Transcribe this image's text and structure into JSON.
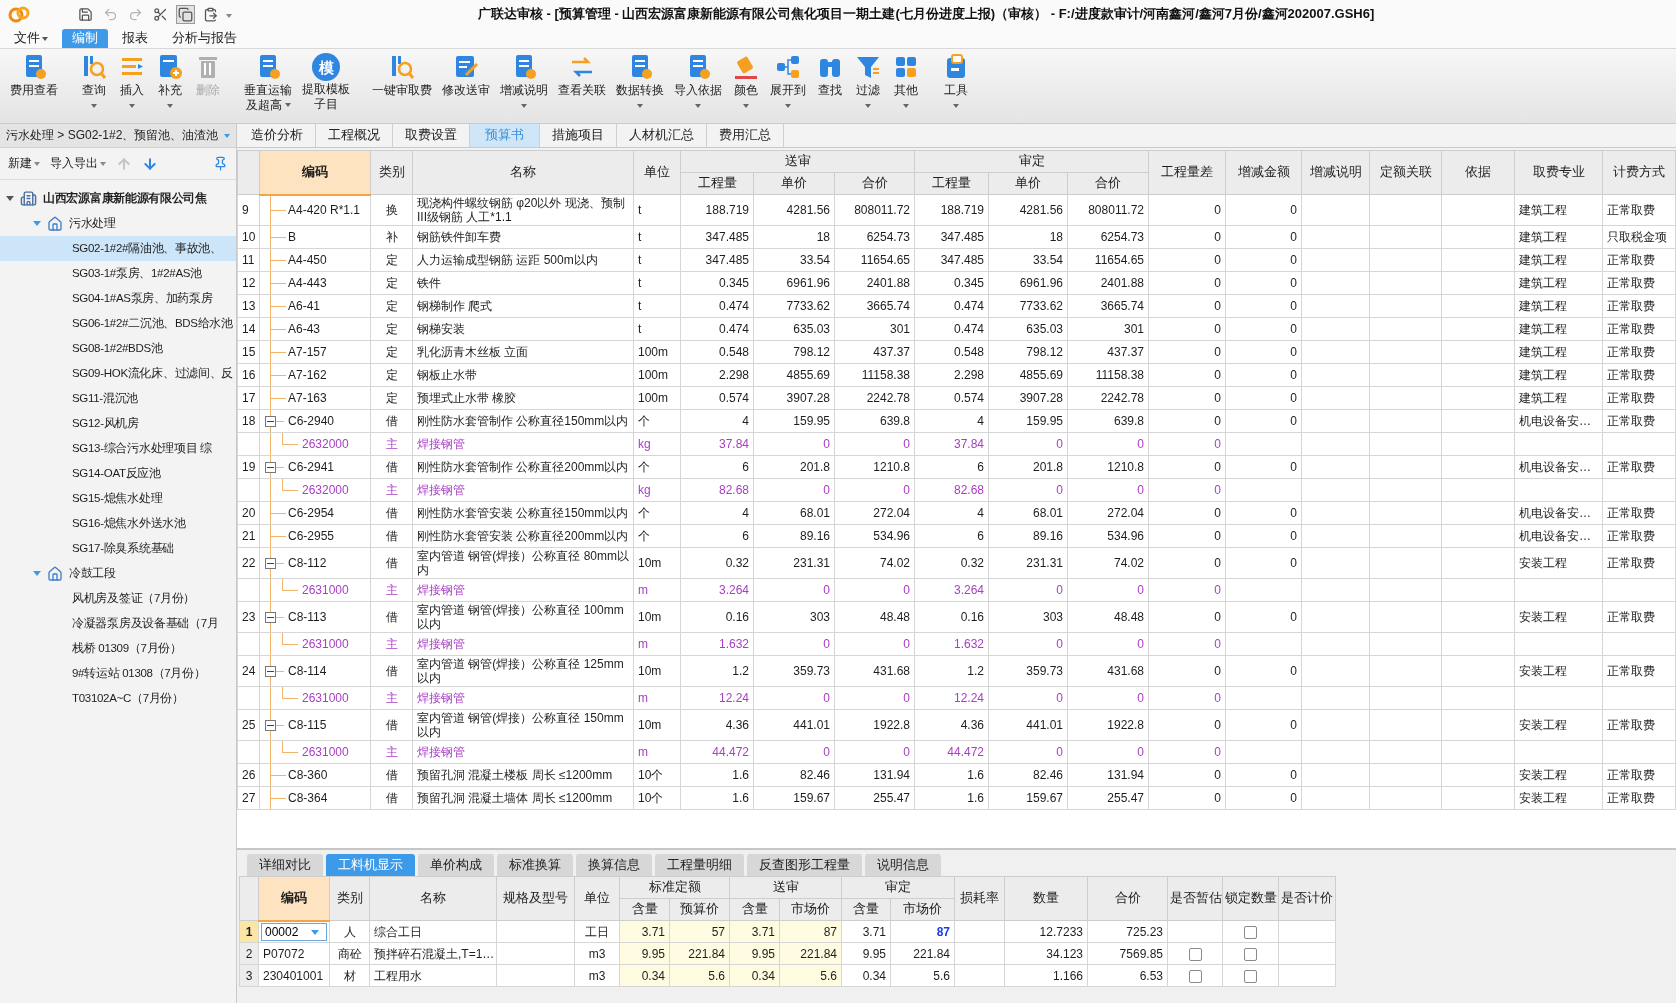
{
  "title_bar": {
    "quick_access": [
      {
        "disabled": false
      },
      {
        "disabled": true
      },
      {
        "disabled": true
      },
      {
        "disabled": false
      },
      {
        "disabled": false
      },
      {
        "disabled": false
      }
    ],
    "title": "广联达审核 - [预算管理 - 山西宏源富康新能源有限公司焦化项目一期土建(七月份进度上报)（审核） - F:/进度款审计/河南鑫河/鑫河7月份/鑫河202007.GSH6]"
  },
  "menu": [
    {
      "label": "文件",
      "dropdown": true,
      "selected": false
    },
    {
      "label": "编制",
      "dropdown": false,
      "selected": true
    },
    {
      "label": "报表",
      "dropdown": false,
      "selected": false
    },
    {
      "label": "分析与报告",
      "dropdown": false,
      "selected": false
    }
  ],
  "toolbar": [
    {
      "buttons": [
        {
          "lines": [
            "费用查看"
          ],
          "dropdown": false,
          "disabled": false
        }
      ]
    },
    {
      "buttons": [
        {
          "lines": [
            "查询"
          ],
          "dropdown": true,
          "disabled": false
        },
        {
          "lines": [
            "插入"
          ],
          "dropdown": true,
          "disabled": false
        },
        {
          "lines": [
            "补充"
          ],
          "dropdown": true,
          "disabled": false
        },
        {
          "lines": [
            "删除"
          ],
          "dropdown": false,
          "disabled": true
        }
      ]
    },
    {
      "buttons": [
        {
          "lines": [
            "垂直运输",
            "及超高"
          ],
          "dropdown": true,
          "disabled": false
        },
        {
          "lines": [
            "提取模板",
            "子目"
          ],
          "dropdown": false,
          "disabled": false,
          "glyph": "模"
        }
      ]
    },
    {
      "buttons": [
        {
          "lines": [
            "一键审取费"
          ],
          "dropdown": false,
          "disabled": false
        },
        {
          "lines": [
            "修改送审"
          ],
          "dropdown": false,
          "disabled": false
        },
        {
          "lines": [
            "增减说明"
          ],
          "dropdown": true,
          "disabled": false
        },
        {
          "lines": [
            "查看关联"
          ],
          "dropdown": false,
          "disabled": false
        },
        {
          "lines": [
            "数据转换"
          ],
          "dropdown": true,
          "disabled": false
        },
        {
          "lines": [
            "导入依据"
          ],
          "dropdown": true,
          "disabled": false
        },
        {
          "lines": [
            "颜色"
          ],
          "dropdown": true,
          "disabled": false
        },
        {
          "lines": [
            "展开到"
          ],
          "dropdown": true,
          "disabled": false
        },
        {
          "lines": [
            "查找"
          ],
          "dropdown": false,
          "disabled": false
        },
        {
          "lines": [
            "过滤"
          ],
          "dropdown": true,
          "disabled": false
        },
        {
          "lines": [
            "其他"
          ],
          "dropdown": true,
          "disabled": false
        }
      ]
    },
    {
      "buttons": [
        {
          "lines": [
            "工具"
          ],
          "dropdown": true,
          "disabled": false
        }
      ]
    }
  ],
  "sidebar": {
    "breadcrumb": "污水处理 > SG02-1#2、预留池、油渣池",
    "tools": [
      {
        "label": "新建",
        "dropdown": true
      },
      {
        "label": "导入导出",
        "dropdown": true
      }
    ],
    "arrows": [
      {
        "disabled": true
      },
      {
        "disabled": false
      }
    ],
    "tree": [
      {
        "label": "山西宏源富康新能源有限公司焦",
        "expanded": true,
        "children": [
          {
            "label": "污水处理",
            "expanded": true,
            "children": [
              {
                "label": "SG02-1#2#隔油池、事故池、",
                "selected": true
              },
              {
                "label": "SG03-1#泵房、1#2#AS池",
                "selected": false
              },
              {
                "label": "SG04-1#AS泵房、加药泵房",
                "selected": false
              },
              {
                "label": "SG06-1#2#二沉池、BDS给水池",
                "selected": false
              },
              {
                "label": "SG08-1#2#BDS池",
                "selected": false
              },
              {
                "label": "SG09-HOK流化床、过滤间、反",
                "selected": false
              },
              {
                "label": "SG11-混沉池",
                "selected": false
              },
              {
                "label": "SG12-风机房",
                "selected": false
              },
              {
                "label": "SG13-综合污水处理项目  综",
                "selected": false
              },
              {
                "label": "SG14-OAT反应池",
                "selected": false
              },
              {
                "label": "SG15-熄焦水处理",
                "selected": false
              },
              {
                "label": "SG16-熄焦水外送水池",
                "selected": false
              },
              {
                "label": "SG17-除臭系统基础",
                "selected": false
              }
            ]
          },
          {
            "label": "冷鼓工段",
            "expanded": true,
            "children": [
              {
                "label": "风机房及签证（7月份）",
                "selected": false
              },
              {
                "label": "冷凝器泵房及设备基础（7月",
                "selected": false
              },
              {
                "label": "栈桥 01309（7月份）",
                "selected": false
              },
              {
                "label": "9#转运站 01308（7月份）",
                "selected": false
              },
              {
                "label": "T03102A~C（7月份）",
                "selected": false
              }
            ]
          }
        ]
      }
    ]
  },
  "tabs": [
    {
      "label": "造价分析",
      "selected": false
    },
    {
      "label": "工程概况",
      "selected": false
    },
    {
      "label": "取费设置",
      "selected": false
    },
    {
      "label": "预算书",
      "selected": true
    },
    {
      "label": "措施项目",
      "selected": false
    },
    {
      "label": "人材机汇总",
      "selected": false
    },
    {
      "label": "费用汇总",
      "selected": false
    }
  ],
  "main_table": {
    "header": [
      {
        "label": "编码",
        "selected": true
      },
      {
        "label": "类别",
        "selected": false
      },
      {
        "label": "名称",
        "selected": false
      },
      {
        "label": "单位",
        "selected": false
      },
      {
        "group": "送审",
        "columns": [
          "工程量",
          "单价",
          "合价"
        ]
      },
      {
        "group": "审定",
        "columns": [
          "工程量",
          "单价",
          "合价"
        ]
      },
      {
        "label": "工程量差",
        "selected": false
      },
      {
        "label": "增减金额",
        "selected": false
      },
      {
        "label": "增减说明",
        "selected": false
      },
      {
        "label": "定额关联",
        "selected": false
      },
      {
        "label": "依据",
        "selected": false
      },
      {
        "label": "取费专业",
        "selected": false
      },
      {
        "label": "计费方式",
        "selected": false
      }
    ],
    "rows": [
      {
        "kind": "item",
        "n": "9",
        "code": "A4-420 R*1.1",
        "type": "换",
        "name": "现浇构件螺纹钢筋 φ20以外  现浇、预制III级钢筋 人工*1.1",
        "unit": "t",
        "sent_qty": "188.719",
        "sent_price": "4281.56",
        "sent_total": "808011.72",
        "appr_qty": "188.719",
        "appr_price": "4281.56",
        "appr_total": "808011.72",
        "qty_diff": "0",
        "change_amount": "0",
        "fee_type": "建筑工程",
        "charge_method": "正常取费"
      },
      {
        "kind": "item",
        "n": "10",
        "code": "B",
        "type": "补",
        "name": "钢筋铁件卸车费",
        "unit": "t",
        "sent_qty": "347.485",
        "sent_price": "18",
        "sent_total": "6254.73",
        "appr_qty": "347.485",
        "appr_price": "18",
        "appr_total": "6254.73",
        "qty_diff": "0",
        "change_amount": "0",
        "fee_type": "建筑工程",
        "charge_method": "只取税金项"
      },
      {
        "kind": "item",
        "n": "11",
        "code": "A4-450",
        "type": "定",
        "name": "人力运输成型钢筋 运距 500m以内",
        "unit": "t",
        "sent_qty": "347.485",
        "sent_price": "33.54",
        "sent_total": "11654.65",
        "appr_qty": "347.485",
        "appr_price": "33.54",
        "appr_total": "11654.65",
        "qty_diff": "0",
        "change_amount": "0",
        "fee_type": "建筑工程",
        "charge_method": "正常取费"
      },
      {
        "kind": "item",
        "n": "12",
        "code": "A4-443",
        "type": "定",
        "name": "铁件",
        "unit": "t",
        "sent_qty": "0.345",
        "sent_price": "6961.96",
        "sent_total": "2401.88",
        "appr_qty": "0.345",
        "appr_price": "6961.96",
        "appr_total": "2401.88",
        "qty_diff": "0",
        "change_amount": "0",
        "fee_type": "建筑工程",
        "charge_method": "正常取费"
      },
      {
        "kind": "item",
        "n": "13",
        "code": "A6-41",
        "type": "定",
        "name": "钢梯制作 爬式",
        "unit": "t",
        "sent_qty": "0.474",
        "sent_price": "7733.62",
        "sent_total": "3665.74",
        "appr_qty": "0.474",
        "appr_price": "7733.62",
        "appr_total": "3665.74",
        "qty_diff": "0",
        "change_amount": "0",
        "fee_type": "建筑工程",
        "charge_method": "正常取费"
      },
      {
        "kind": "item",
        "n": "14",
        "code": "A6-43",
        "type": "定",
        "name": "钢梯安装",
        "unit": "t",
        "sent_qty": "0.474",
        "sent_price": "635.03",
        "sent_total": "301",
        "appr_qty": "0.474",
        "appr_price": "635.03",
        "appr_total": "301",
        "qty_diff": "0",
        "change_amount": "0",
        "fee_type": "建筑工程",
        "charge_method": "正常取费"
      },
      {
        "kind": "item",
        "n": "15",
        "code": "A7-157",
        "type": "定",
        "name": "乳化沥青木丝板 立面",
        "unit": "100m",
        "sent_qty": "0.548",
        "sent_price": "798.12",
        "sent_total": "437.37",
        "appr_qty": "0.548",
        "appr_price": "798.12",
        "appr_total": "437.37",
        "qty_diff": "0",
        "change_amount": "0",
        "fee_type": "建筑工程",
        "charge_method": "正常取费"
      },
      {
        "kind": "item",
        "n": "16",
        "code": "A7-162",
        "type": "定",
        "name": "钢板止水带",
        "unit": "100m",
        "sent_qty": "2.298",
        "sent_price": "4855.69",
        "sent_total": "11158.38",
        "appr_qty": "2.298",
        "appr_price": "4855.69",
        "appr_total": "11158.38",
        "qty_diff": "0",
        "change_amount": "0",
        "fee_type": "建筑工程",
        "charge_method": "正常取费"
      },
      {
        "kind": "item",
        "n": "17",
        "code": "A7-163",
        "type": "定",
        "name": "预埋式止水带 橡胶",
        "unit": "100m",
        "sent_qty": "0.574",
        "sent_price": "3907.28",
        "sent_total": "2242.78",
        "appr_qty": "0.574",
        "appr_price": "3907.28",
        "appr_total": "2242.78",
        "qty_diff": "0",
        "change_amount": "0",
        "fee_type": "建筑工程",
        "charge_method": "正常取费"
      },
      {
        "kind": "item",
        "n": "18",
        "code": "C6-2940",
        "type": "借",
        "name": "刚性防水套管制作 公称直径150mm以内",
        "unit": "个",
        "sent_qty": "4",
        "sent_price": "159.95",
        "sent_total": "639.8",
        "appr_qty": "4",
        "appr_price": "159.95",
        "appr_total": "639.8",
        "qty_diff": "0",
        "change_amount": "0",
        "fee_type": "机电设备安…",
        "charge_method": "正常取费",
        "expanded": true,
        "children": [
          {
            "kind": "material",
            "code": "2632000",
            "type": "主",
            "name": "焊接钢管",
            "unit": "kg",
            "sent_qty": "37.84",
            "sent_price": "0",
            "sent_total": "0",
            "appr_qty": "37.84",
            "appr_price": "0",
            "appr_total": "0",
            "qty_diff": "0"
          }
        ]
      },
      {
        "kind": "item",
        "n": "19",
        "code": "C6-2941",
        "type": "借",
        "name": "刚性防水套管制作 公称直径200mm以内",
        "unit": "个",
        "sent_qty": "6",
        "sent_price": "201.8",
        "sent_total": "1210.8",
        "appr_qty": "6",
        "appr_price": "201.8",
        "appr_total": "1210.8",
        "qty_diff": "0",
        "change_amount": "0",
        "fee_type": "机电设备安…",
        "charge_method": "正常取费",
        "expanded": true,
        "children": [
          {
            "kind": "material",
            "code": "2632000",
            "type": "主",
            "name": "焊接钢管",
            "unit": "kg",
            "sent_qty": "82.68",
            "sent_price": "0",
            "sent_total": "0",
            "appr_qty": "82.68",
            "appr_price": "0",
            "appr_total": "0",
            "qty_diff": "0"
          }
        ]
      },
      {
        "kind": "item",
        "n": "20",
        "code": "C6-2954",
        "type": "借",
        "name": "刚性防水套管安装 公称直径150mm以内",
        "unit": "个",
        "sent_qty": "4",
        "sent_price": "68.01",
        "sent_total": "272.04",
        "appr_qty": "4",
        "appr_price": "68.01",
        "appr_total": "272.04",
        "qty_diff": "0",
        "change_amount": "0",
        "fee_type": "机电设备安…",
        "charge_method": "正常取费"
      },
      {
        "kind": "item",
        "n": "21",
        "code": "C6-2955",
        "type": "借",
        "name": "刚性防水套管安装 公称直径200mm以内",
        "unit": "个",
        "sent_qty": "6",
        "sent_price": "89.16",
        "sent_total": "534.96",
        "appr_qty": "6",
        "appr_price": "89.16",
        "appr_total": "534.96",
        "qty_diff": "0",
        "change_amount": "0",
        "fee_type": "机电设备安…",
        "charge_method": "正常取费"
      },
      {
        "kind": "item",
        "n": "22",
        "code": "C8-112",
        "type": "借",
        "name": "室内管道 钢管(焊接）公称直径 80mm以内",
        "unit": "10m",
        "sent_qty": "0.32",
        "sent_price": "231.31",
        "sent_total": "74.02",
        "appr_qty": "0.32",
        "appr_price": "231.31",
        "appr_total": "74.02",
        "qty_diff": "0",
        "change_amount": "0",
        "fee_type": "安装工程",
        "charge_method": "正常取费",
        "expanded": true,
        "children": [
          {
            "kind": "material",
            "code": "2631000",
            "type": "主",
            "name": "焊接钢管",
            "unit": "m",
            "sent_qty": "3.264",
            "sent_price": "0",
            "sent_total": "0",
            "appr_qty": "3.264",
            "appr_price": "0",
            "appr_total": "0",
            "qty_diff": "0"
          }
        ]
      },
      {
        "kind": "item",
        "n": "23",
        "code": "C8-113",
        "type": "借",
        "name": "室内管道 钢管(焊接）公称直径 100mm以内",
        "unit": "10m",
        "sent_qty": "0.16",
        "sent_price": "303",
        "sent_total": "48.48",
        "appr_qty": "0.16",
        "appr_price": "303",
        "appr_total": "48.48",
        "qty_diff": "0",
        "change_amount": "0",
        "fee_type": "安装工程",
        "charge_method": "正常取费",
        "expanded": true,
        "children": [
          {
            "kind": "material",
            "code": "2631000",
            "type": "主",
            "name": "焊接钢管",
            "unit": "m",
            "sent_qty": "1.632",
            "sent_price": "0",
            "sent_total": "0",
            "appr_qty": "1.632",
            "appr_price": "0",
            "appr_total": "0",
            "qty_diff": "0"
          }
        ]
      },
      {
        "kind": "item",
        "n": "24",
        "code": "C8-114",
        "type": "借",
        "name": "室内管道 钢管(焊接）公称直径 125mm以内",
        "unit": "10m",
        "sent_qty": "1.2",
        "sent_price": "359.73",
        "sent_total": "431.68",
        "appr_qty": "1.2",
        "appr_price": "359.73",
        "appr_total": "431.68",
        "qty_diff": "0",
        "change_amount": "0",
        "fee_type": "安装工程",
        "charge_method": "正常取费",
        "expanded": true,
        "children": [
          {
            "kind": "material",
            "code": "2631000",
            "type": "主",
            "name": "焊接钢管",
            "unit": "m",
            "sent_qty": "12.24",
            "sent_price": "0",
            "sent_total": "0",
            "appr_qty": "12.24",
            "appr_price": "0",
            "appr_total": "0",
            "qty_diff": "0"
          }
        ]
      },
      {
        "kind": "item",
        "n": "25",
        "code": "C8-115",
        "type": "借",
        "name": "室内管道 钢管(焊接）公称直径 150mm以内",
        "unit": "10m",
        "sent_qty": "4.36",
        "sent_price": "441.01",
        "sent_total": "1922.8",
        "appr_qty": "4.36",
        "appr_price": "441.01",
        "appr_total": "1922.8",
        "qty_diff": "0",
        "change_amount": "0",
        "fee_type": "安装工程",
        "charge_method": "正常取费",
        "expanded": true,
        "children": [
          {
            "kind": "material",
            "code": "2631000",
            "type": "主",
            "name": "焊接钢管",
            "unit": "m",
            "sent_qty": "44.472",
            "sent_price": "0",
            "sent_total": "0",
            "appr_qty": "44.472",
            "appr_price": "0",
            "appr_total": "0",
            "qty_diff": "0"
          }
        ]
      },
      {
        "kind": "item",
        "n": "26",
        "code": "C8-360",
        "type": "借",
        "name": "预留孔洞 混凝土楼板 周长 ≤1200mm",
        "unit": "10个",
        "sent_qty": "1.6",
        "sent_price": "82.46",
        "sent_total": "131.94",
        "appr_qty": "1.6",
        "appr_price": "82.46",
        "appr_total": "131.94",
        "qty_diff": "0",
        "change_amount": "0",
        "fee_type": "安装工程",
        "charge_method": "正常取费"
      },
      {
        "kind": "item",
        "n": "27",
        "code": "C8-364",
        "type": "借",
        "name": "预留孔洞 混凝土墙体 周长 ≤1200mm",
        "unit": "10个",
        "sent_qty": "1.6",
        "sent_price": "159.67",
        "sent_total": "255.47",
        "appr_qty": "1.6",
        "appr_price": "159.67",
        "appr_total": "255.47",
        "qty_diff": "0",
        "change_amount": "0",
        "fee_type": "安装工程",
        "charge_method": "正常取费"
      }
    ]
  },
  "bottom_panel": {
    "tabs": [
      {
        "label": "详细对比",
        "selected": false
      },
      {
        "label": "工料机显示",
        "selected": true
      },
      {
        "label": "单价构成",
        "selected": false
      },
      {
        "label": "标准换算",
        "selected": false
      },
      {
        "label": "换算信息",
        "selected": false
      },
      {
        "label": "工程量明细",
        "selected": false
      },
      {
        "label": "反查图形工程量",
        "selected": false
      },
      {
        "label": "说明信息",
        "selected": false
      }
    ],
    "table": {
      "header": [
        {
          "label": "编码",
          "selected": true
        },
        {
          "label": "类别",
          "selected": false
        },
        {
          "label": "名称",
          "selected": false
        },
        {
          "label": "规格及型号",
          "selected": false
        },
        {
          "label": "单位",
          "selected": false
        },
        {
          "group": "标准定额",
          "columns": [
            "含量",
            "预算价"
          ]
        },
        {
          "group": "送审",
          "columns": [
            "含量",
            "市场价"
          ]
        },
        {
          "group": "审定",
          "columns": [
            "含量",
            "市场价"
          ]
        },
        {
          "label": "损耗率",
          "selected": false
        },
        {
          "label": "数量",
          "selected": false
        },
        {
          "label": "合价",
          "selected": false
        },
        {
          "label": "是否暂估",
          "selected": false
        },
        {
          "label": "锁定数量",
          "selected": false
        },
        {
          "label": "是否计价",
          "selected": false
        }
      ],
      "rows": [
        {
          "n": "1",
          "selected": true,
          "code": "00002",
          "type": "人",
          "name": "综合工日",
          "unit": "工日",
          "std_qty": "3.71",
          "std_price": "57",
          "sent_qty": "3.71",
          "sent_price": "87",
          "appr_qty": "3.71",
          "appr_price": "87",
          "price_modified": true,
          "quantity": "12.7233",
          "total": "725.23",
          "locked": false
        },
        {
          "n": "2",
          "selected": false,
          "code": "P07072",
          "type": "商砼",
          "name": "预拌碎石混凝土,T=1…",
          "unit": "m3",
          "std_qty": "9.95",
          "std_price": "221.84",
          "sent_qty": "9.95",
          "sent_price": "221.84",
          "appr_qty": "9.95",
          "appr_price": "221.84",
          "price_modified": false,
          "quantity": "34.123",
          "total": "7569.85",
          "estimate": false,
          "locked": false
        },
        {
          "n": "3",
          "selected": false,
          "code": "230401001",
          "type": "材",
          "name": "工程用水",
          "unit": "m3",
          "std_qty": "0.34",
          "std_price": "5.6",
          "sent_qty": "0.34",
          "sent_price": "5.6",
          "appr_qty": "0.34",
          "appr_price": "5.6",
          "price_modified": false,
          "quantity": "1.166",
          "total": "6.53",
          "estimate": false,
          "locked": false
        }
      ]
    }
  }
}
